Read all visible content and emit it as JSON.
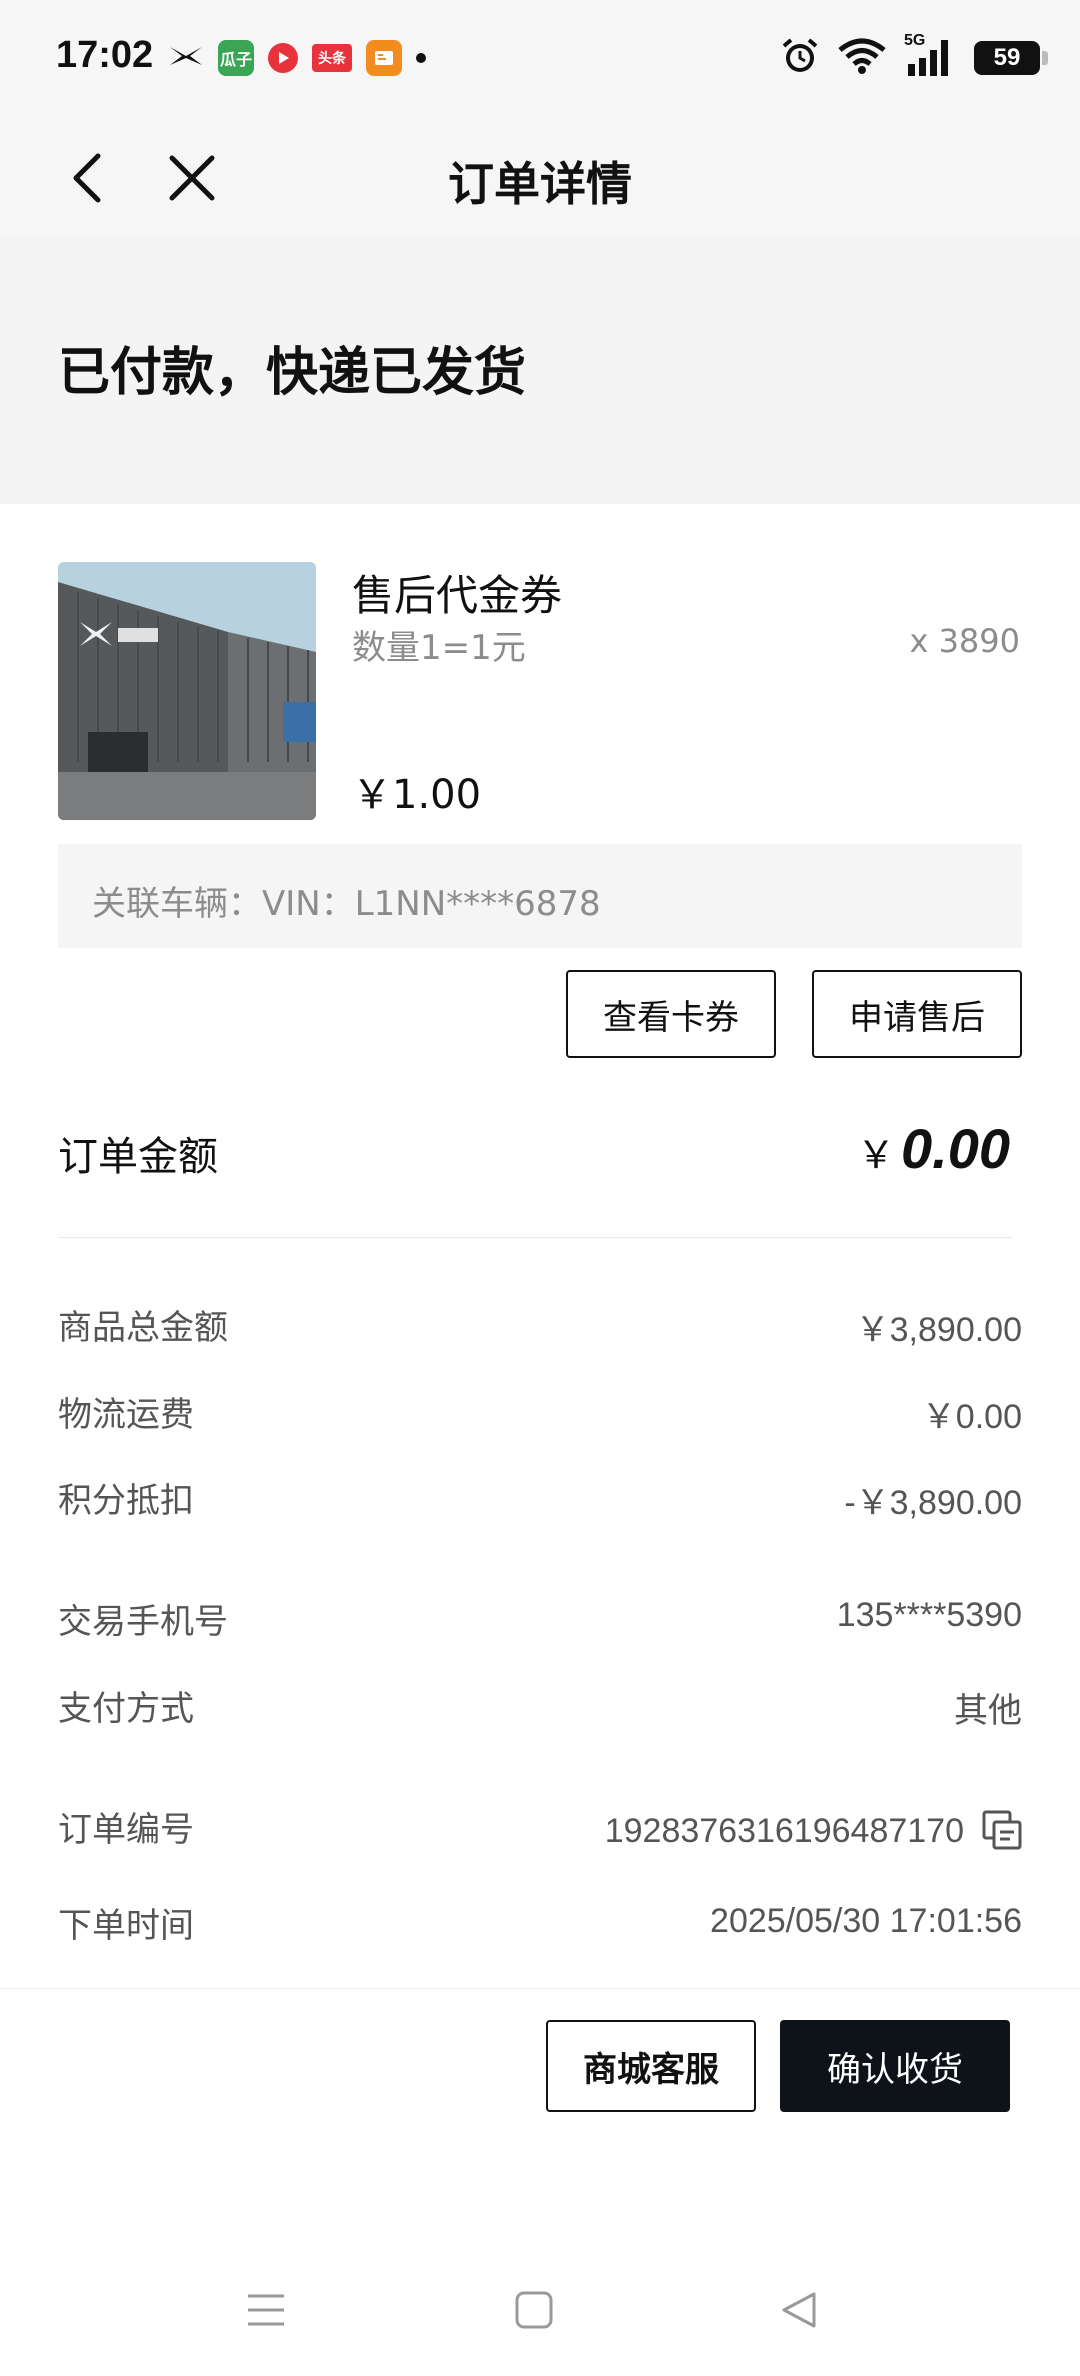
{
  "status_bar": {
    "time": "17:02",
    "app_icons": [
      "xpeng-icon",
      "guazi-icon",
      "video-icon",
      "toutiao-icon",
      "reader-icon"
    ],
    "guazi_label": "瓜子",
    "toutiao_label": "头条",
    "signal_label": "5G",
    "battery": "59"
  },
  "nav": {
    "title": "订单详情"
  },
  "banner": {
    "status_text": "已付款，快递已发货"
  },
  "product": {
    "name": "售后代金券",
    "spec": "数量1=1元",
    "quantity": "x 3890",
    "price": "￥1.00",
    "vin": "关联车辆：VIN：L1NN****6878"
  },
  "actions": {
    "view_coupon": "查看卡券",
    "after_sale": "申请售后"
  },
  "order_amount": {
    "label": "订单金额",
    "currency": "￥",
    "value": "0.00"
  },
  "details": [
    {
      "label": "商品总金额",
      "value": "￥3,890.00"
    },
    {
      "label": "物流运费",
      "value": "￥0.00"
    },
    {
      "label": "积分抵扣",
      "value": "-￥3,890.00"
    },
    {
      "label": "交易手机号",
      "value": "135****5390"
    },
    {
      "label": "支付方式",
      "value": "其他"
    },
    {
      "label": "订单编号",
      "value": "1928376316196487170"
    },
    {
      "label": "下单时间",
      "value": "2025/05/30 17:01:56"
    }
  ],
  "footer": {
    "service_button": "商城客服",
    "confirm_button": "确认收货"
  },
  "colors": {
    "dark_button": "#0e1219",
    "muted_text": "#8c8c8c",
    "header_bg": "#f6f6f6"
  }
}
